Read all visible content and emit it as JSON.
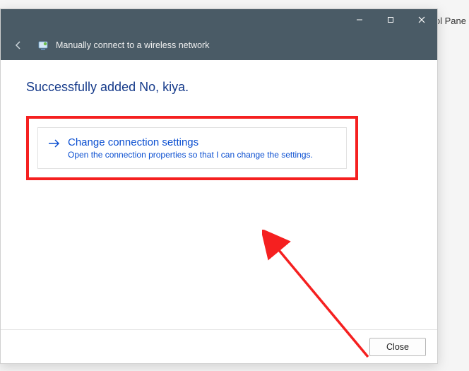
{
  "background": {
    "partial_text": "ntrol Pane"
  },
  "window": {
    "header_title": "Manually connect to a wireless network",
    "controls": {
      "minimize": "minimize",
      "maximize": "maximize",
      "close": "close"
    }
  },
  "content": {
    "success_message": "Successfully added No, kiya.",
    "option": {
      "title": "Change connection settings",
      "description": "Open the connection properties so that I can change the settings."
    }
  },
  "footer": {
    "close_label": "Close"
  }
}
